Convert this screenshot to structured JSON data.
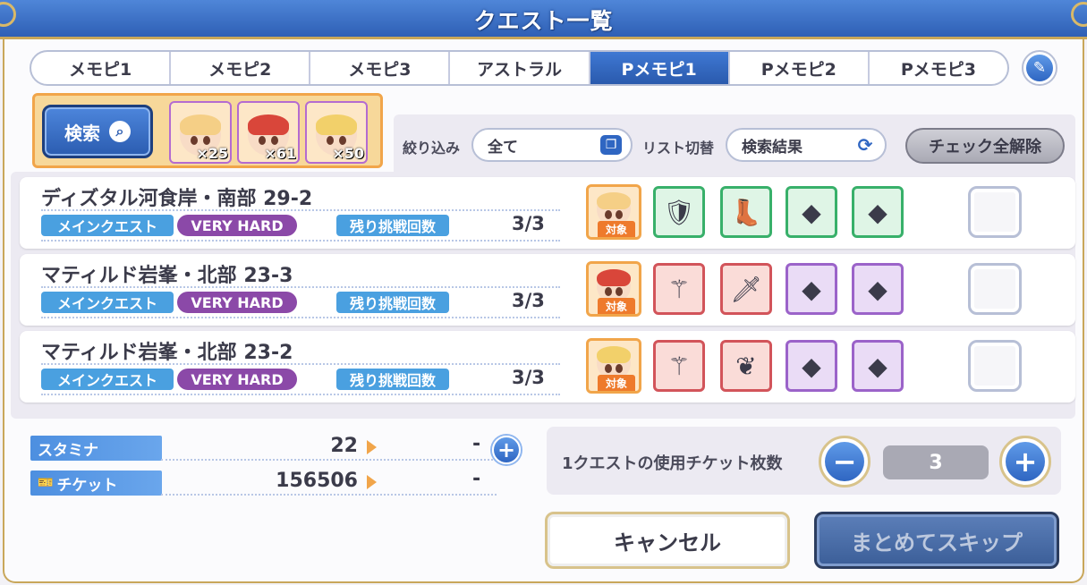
{
  "window": {
    "title": "クエスト一覧"
  },
  "tabs": [
    {
      "label": "メモピ1"
    },
    {
      "label": "メモピ2"
    },
    {
      "label": "メモピ3"
    },
    {
      "label": "アストラル"
    },
    {
      "label": "Pメモピ1",
      "active": true
    },
    {
      "label": "Pメモピ2"
    },
    {
      "label": "Pメモピ3"
    }
  ],
  "search": {
    "button_label": "検索",
    "characters": [
      {
        "count": "×25",
        "hair": "#f5cf86"
      },
      {
        "count": "×61",
        "hair": "#d9463a"
      },
      {
        "count": "×50",
        "hair": "#f2d06a"
      }
    ]
  },
  "filter": {
    "narrow_label": "絞り込み",
    "narrow_value": "全て",
    "list_label": "リスト切替",
    "list_value": "検索結果",
    "uncheck_all": "チェック全解除"
  },
  "quests": [
    {
      "name": "ディズタル河食岸・南部 29-2",
      "type": "メインクエスト",
      "difficulty": "VERY HARD",
      "remaining_label": "残り挑戦回数",
      "remaining": "3/3",
      "target_tag": "対象",
      "target_hair": "#f5cf86",
      "items": [
        "green",
        "green",
        "green-shard",
        "green-shard"
      ]
    },
    {
      "name": "マティルド岩峯・北部 23-3",
      "type": "メインクエスト",
      "difficulty": "VERY HARD",
      "remaining_label": "残り挑戦回数",
      "remaining": "3/3",
      "target_tag": "対象",
      "target_hair": "#d9463a",
      "items": [
        "red",
        "red",
        "purple-shard",
        "purple-shard"
      ]
    },
    {
      "name": "マティルド岩峯・北部 23-2",
      "type": "メインクエスト",
      "difficulty": "VERY HARD",
      "remaining_label": "残り挑戦回数",
      "remaining": "3/3",
      "target_tag": "対象",
      "target_hair": "#f2d06a",
      "items": [
        "red",
        "red",
        "purple-shard",
        "purple-shard"
      ]
    }
  ],
  "stats": {
    "stamina_label": "スタミナ",
    "stamina_value": "22",
    "stamina_after": "-",
    "ticket_label": "チケット",
    "ticket_value": "156506",
    "ticket_after": "-"
  },
  "tickets": {
    "label": "1クエストの使用チケット枚数",
    "value": "3"
  },
  "buttons": {
    "cancel": "キャンセル",
    "skip": "まとめてスキップ"
  }
}
